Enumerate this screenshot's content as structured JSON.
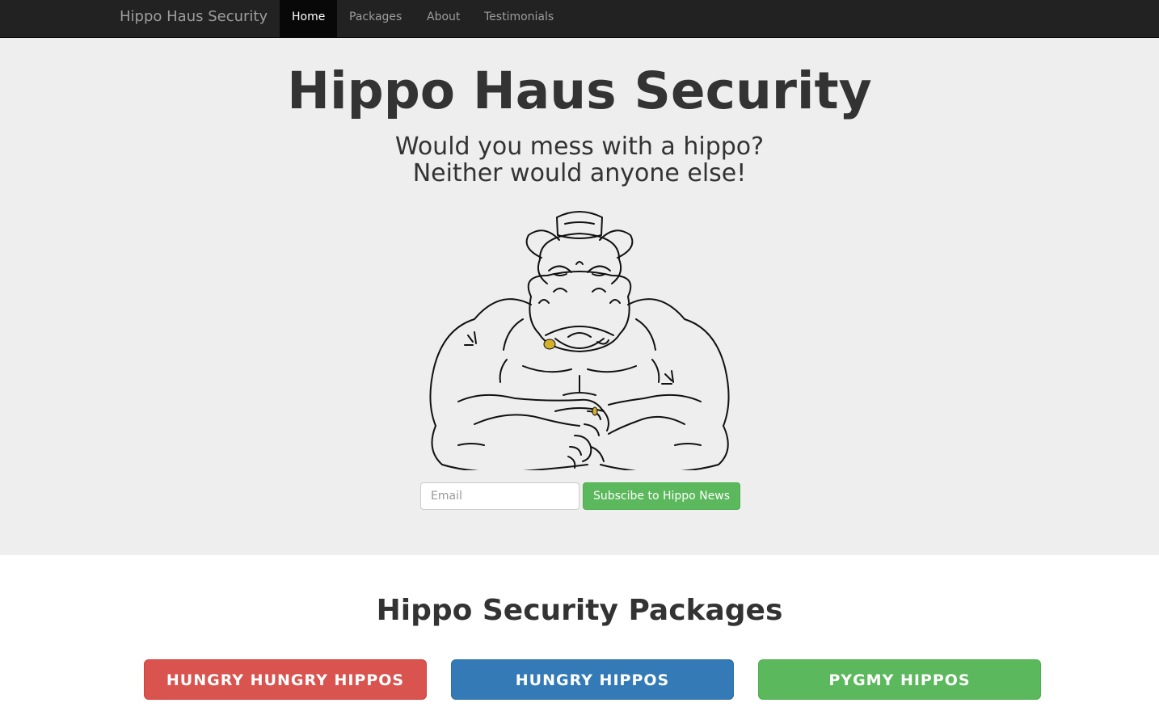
{
  "navbar": {
    "brand": "Hippo Haus Security",
    "items": [
      {
        "label": "Home",
        "active": true
      },
      {
        "label": "Packages",
        "active": false
      },
      {
        "label": "About",
        "active": false
      },
      {
        "label": "Testimonials",
        "active": false
      }
    ]
  },
  "hero": {
    "title": "Hippo Haus Security",
    "subtitle_line1": "Would you mess with a hippo?",
    "subtitle_line2": "Neither would anyone else!",
    "image_icon": "hippo-mascot-illustration"
  },
  "subscribe": {
    "email_placeholder": "Email",
    "email_value": "",
    "button_label": "Subscibe to Hippo News"
  },
  "packages": {
    "title": "Hippo Security Packages",
    "buttons": [
      {
        "label": "HUNGRY HUNGRY HIPPOS",
        "color": "#d9534f"
      },
      {
        "label": "HUNGRY HIPPOS",
        "color": "#337ab7"
      },
      {
        "label": "PYGMY HIPPOS",
        "color": "#5cb85c"
      }
    ]
  },
  "colors": {
    "navbar_bg": "#222222",
    "hero_bg": "#eeeeee",
    "gold_accent": "#d4b12a"
  }
}
